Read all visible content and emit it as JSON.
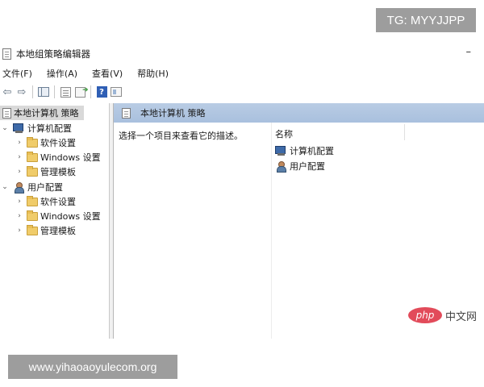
{
  "watermarks": {
    "top": "TG: MYYJJPP",
    "bottom": "www.yihaoaoyulecom.org"
  },
  "window": {
    "title": "本地组策略编辑器",
    "minimize_glyph": "–"
  },
  "menu": {
    "items": [
      {
        "label": "文件(F)"
      },
      {
        "label": "操作(A)"
      },
      {
        "label": "查看(V)"
      },
      {
        "label": "帮助(H)"
      }
    ]
  },
  "toolbar": {
    "back_icon": "back-arrow-icon",
    "forward_icon": "forward-arrow-icon",
    "back_glyph": "⇦",
    "forward_glyph": "⇨",
    "help_glyph": "?"
  },
  "tree": {
    "root": {
      "label": "本地计算机 策略"
    },
    "computer_config": {
      "label": "计算机配置",
      "children": [
        {
          "label": "软件设置"
        },
        {
          "label": "Windows 设置"
        },
        {
          "label": "管理模板"
        }
      ]
    },
    "user_config": {
      "label": "用户配置",
      "children": [
        {
          "label": "软件设置"
        },
        {
          "label": "Windows 设置"
        },
        {
          "label": "管理模板"
        }
      ]
    },
    "expanded_chevron": "⌄",
    "collapsed_chevron": "›"
  },
  "details": {
    "header": "本地计算机 策略",
    "description": "选择一个项目来查看它的描述。",
    "column_name": "名称",
    "items": [
      {
        "label": "计算机配置"
      },
      {
        "label": "用户配置"
      }
    ]
  },
  "brand": {
    "logo_text": "php",
    "site_text": "中文网",
    "logo_color": "#e24b5a"
  }
}
